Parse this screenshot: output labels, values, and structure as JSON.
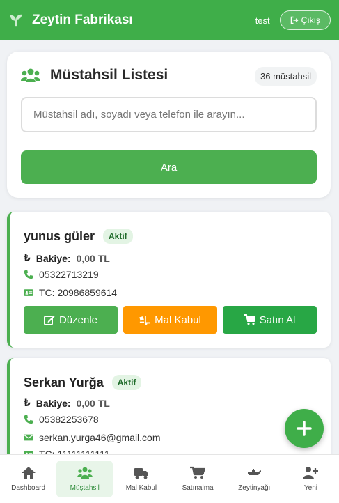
{
  "header": {
    "brand": "Zeytin Fabrikası",
    "user": "test",
    "logout_label": "Çıkış"
  },
  "search": {
    "title": "Müstahsil Listesi",
    "count_badge": "36 müstahsil",
    "placeholder": "Müstahsil adı, soyadı veya telefon ile arayın...",
    "button_label": "Ara"
  },
  "farmers": [
    {
      "name": "yunus güler",
      "status": "Aktif",
      "balance_label": "Bakiye:",
      "balance": "0,00 TL",
      "phone": "05322713219",
      "tc": "TC: 20986859614"
    },
    {
      "name": "Serkan Yurğa",
      "status": "Aktif",
      "balance_label": "Bakiye:",
      "balance": "0,00 TL",
      "phone": "05382253678",
      "email": "serkan.yurga46@gmail.com",
      "tc": "TC: 11111111111"
    }
  ],
  "actions": {
    "edit": "Düzenle",
    "receive": "Mal Kabul",
    "buy": "Satın Al"
  },
  "nav": [
    {
      "label": "Dashboard",
      "icon": "home-icon"
    },
    {
      "label": "Müştahsil",
      "icon": "users-icon",
      "active": true
    },
    {
      "label": "Mal Kabul",
      "icon": "truck-icon"
    },
    {
      "label": "Satınalma",
      "icon": "cart-icon"
    },
    {
      "label": "Zeytinyağı",
      "icon": "oil-can-icon"
    },
    {
      "label": "Yeni",
      "icon": "user-plus-icon"
    }
  ],
  "colors": {
    "primary": "#4caf50",
    "header": "#3fae49",
    "orange": "#ff9800",
    "buy_green": "#28a745"
  }
}
